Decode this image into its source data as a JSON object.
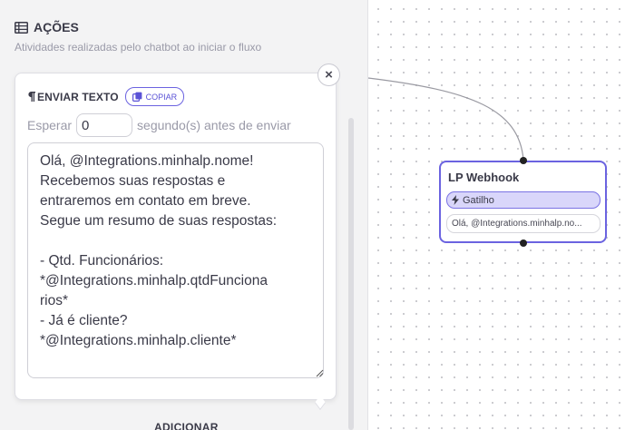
{
  "panel": {
    "title": "AÇÕES",
    "subtitle": "Atividades realizadas pelo chatbot ao iniciar o fluxo",
    "add_label": "ADICIONAR"
  },
  "card": {
    "title": "ENVIAR TEXTO",
    "copy_label": "COPIAR",
    "wait_prefix": "Esperar",
    "wait_value": "0",
    "wait_suffix": "segundo(s) antes de enviar",
    "message": "Olá, @Integrations.minhalp.nome!\nRecebemos suas respostas e\nentraremos em contato em breve.\nSegue um resumo de suas respostas:\n\n- Qtd. Funcionários:\n*@Integrations.minhalp.qtdFunciona\nrios*\n- Já é cliente?\n*@Integrations.minhalp.cliente*",
    "close_glyph": "×"
  },
  "node": {
    "title": "LP Webhook",
    "trigger_label": "Gatilho",
    "message_preview": "Olá, @Integrations.minhalp.no..."
  },
  "colors": {
    "accent": "#6b63e0",
    "trigger_bg": "#d9d6fa",
    "text": "#3a3a48",
    "muted": "#9a9aa8",
    "panel_bg": "#f3f3f4"
  },
  "icons": {
    "panel_title": "table-list-icon",
    "card_title": "pilcrow-icon",
    "copy": "copy-icon",
    "trigger": "lightning-icon"
  }
}
